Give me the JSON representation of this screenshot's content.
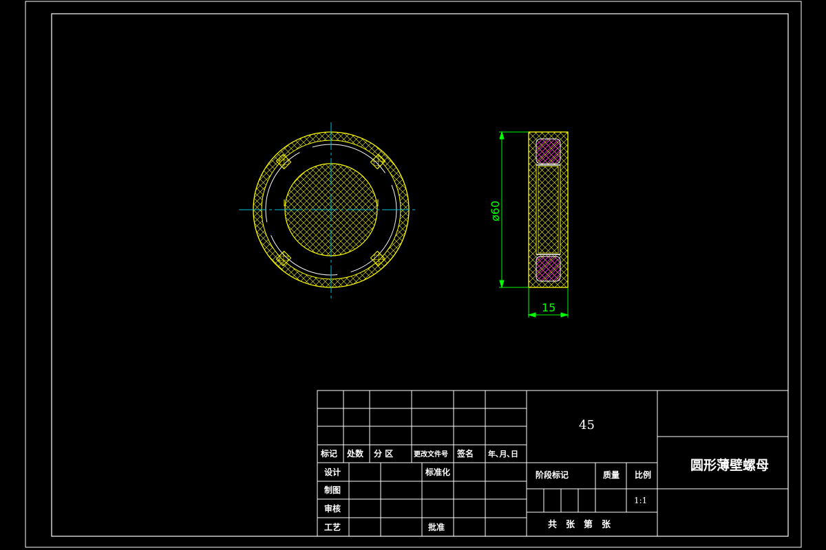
{
  "dimensions": {
    "diameter": "ø60",
    "thickness": "15"
  },
  "title_block": {
    "material": "45",
    "part_name": "圆形薄壁螺母",
    "scale_label": "比例",
    "scale_value": "1:1",
    "stage_mark": "阶段标记",
    "weight": "质量",
    "sheets": "共　张　第　张",
    "revision_headers": [
      "标记",
      "处数",
      "分 区",
      "更改文件号",
      "签名",
      "年､月､日"
    ],
    "roles": {
      "design": "设计",
      "draw": "制图",
      "review": "审核",
      "process": "工艺",
      "standard": "标准化",
      "approve": "批准"
    }
  },
  "colors": {
    "frame": "#ffffff",
    "outline": "#ffff00",
    "hatch": "#ffff00",
    "center": "#00c0e0",
    "dimension": "#00ff00",
    "magenta": "#ff00ff"
  }
}
